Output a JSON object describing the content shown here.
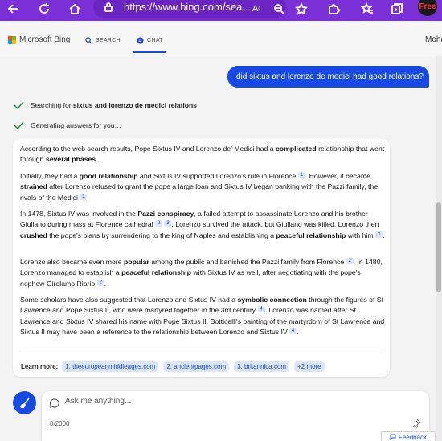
{
  "browser": {
    "url": "https://www.bing.com/sea...",
    "avatar_text": "Free"
  },
  "header": {
    "logo_text": "Microsoft Bing",
    "nav": {
      "search_label": "SEARCH",
      "chat_label": "CHAT"
    },
    "user_name": "Moha"
  },
  "conversation": {
    "user_message": "did sixtus and lorenzo de medici had good relations?",
    "status_search_prefix": "Searching for: ",
    "status_search_query": "sixtus and lorenzo de medici relations",
    "status_generating": "Generating answers for you…"
  },
  "answer": {
    "p1": [
      "According to the web search results, Pope Sixtus IV and Lorenzo de' Medici had a ",
      "complicated",
      " relationship that went through ",
      "several phases",
      "."
    ],
    "p2": [
      "Initially, they had a ",
      "good relationship",
      " and Sixtus IV supported Lorenzo's rule in Florence",
      "1",
      ". However, it became ",
      "strained",
      " after Lorenzo refused to grant the pope a large loan and Sixtus IV began banking with the Pazzi family, the rivals of the Medici",
      "1",
      "."
    ],
    "p3": [
      "In 1478, Sixtus IV was involved in the ",
      "Pazzi conspiracy",
      ", a failed attempt to assassinate Lorenzo and his brother Giuliano during mass at Florence cathedral",
      "2",
      "3",
      ". Lorenzo survived the attack, but Giuliano was killed. Lorenzo then ",
      "crushed",
      " the pope's plans by surrendering to the king of Naples and establishing a ",
      "peaceful relationship",
      " with him",
      "3",
      "."
    ],
    "p4": [
      "Lorenzo also became even more ",
      "popular",
      " among the public and banished the Pazzi family from Florence",
      "2",
      ". In 1480, Lorenzo managed to establish a ",
      "peaceful relationship",
      " with Sixtus IV as well, after negotiating with the pope's nephew Girolamo Riario",
      "2",
      "."
    ],
    "p5": [
      "Some scholars have also suggested that Lorenzo and Sixtus IV had a ",
      "symbolic connection",
      " through the figures of St Lawrence and Pope Sixtus II, who were martyred together in the 3rd century",
      "4",
      ". Lorenzo was named after St Lawrence and Sixtus IV shared his name with Pope Sixtus II. Botticelli's painting of the martyrdom of St Lawrence and Sixtus II may have been a reference to the relationship between Lorenzo and Sixtus IV",
      "4",
      "."
    ],
    "learn_more_label": "Learn more:",
    "links": [
      "1. theeuropeanmiddleages.com",
      "2. ancientpages.com",
      "3. britannica.com",
      "+2 more"
    ]
  },
  "composer": {
    "placeholder": "Ask me anything...",
    "char_count": "0/2000"
  },
  "feedback_label": "Feedback",
  "colors": {
    "brand_purple": "#7b2fd6",
    "accent_blue": "#174ae4",
    "check_green": "#2a8a3e"
  }
}
